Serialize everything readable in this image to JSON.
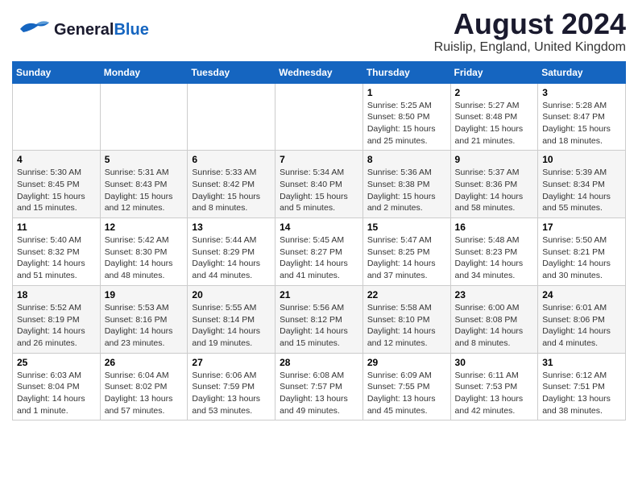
{
  "logo": {
    "general": "General",
    "blue": "Blue"
  },
  "header": {
    "month_year": "August 2024",
    "location": "Ruislip, England, United Kingdom"
  },
  "days_of_week": [
    "Sunday",
    "Monday",
    "Tuesday",
    "Wednesday",
    "Thursday",
    "Friday",
    "Saturday"
  ],
  "weeks": [
    [
      {
        "day": "",
        "info": ""
      },
      {
        "day": "",
        "info": ""
      },
      {
        "day": "",
        "info": ""
      },
      {
        "day": "",
        "info": ""
      },
      {
        "day": "1",
        "info": "Sunrise: 5:25 AM\nSunset: 8:50 PM\nDaylight: 15 hours\nand 25 minutes."
      },
      {
        "day": "2",
        "info": "Sunrise: 5:27 AM\nSunset: 8:48 PM\nDaylight: 15 hours\nand 21 minutes."
      },
      {
        "day": "3",
        "info": "Sunrise: 5:28 AM\nSunset: 8:47 PM\nDaylight: 15 hours\nand 18 minutes."
      }
    ],
    [
      {
        "day": "4",
        "info": "Sunrise: 5:30 AM\nSunset: 8:45 PM\nDaylight: 15 hours\nand 15 minutes."
      },
      {
        "day": "5",
        "info": "Sunrise: 5:31 AM\nSunset: 8:43 PM\nDaylight: 15 hours\nand 12 minutes."
      },
      {
        "day": "6",
        "info": "Sunrise: 5:33 AM\nSunset: 8:42 PM\nDaylight: 15 hours\nand 8 minutes."
      },
      {
        "day": "7",
        "info": "Sunrise: 5:34 AM\nSunset: 8:40 PM\nDaylight: 15 hours\nand 5 minutes."
      },
      {
        "day": "8",
        "info": "Sunrise: 5:36 AM\nSunset: 8:38 PM\nDaylight: 15 hours\nand 2 minutes."
      },
      {
        "day": "9",
        "info": "Sunrise: 5:37 AM\nSunset: 8:36 PM\nDaylight: 14 hours\nand 58 minutes."
      },
      {
        "day": "10",
        "info": "Sunrise: 5:39 AM\nSunset: 8:34 PM\nDaylight: 14 hours\nand 55 minutes."
      }
    ],
    [
      {
        "day": "11",
        "info": "Sunrise: 5:40 AM\nSunset: 8:32 PM\nDaylight: 14 hours\nand 51 minutes."
      },
      {
        "day": "12",
        "info": "Sunrise: 5:42 AM\nSunset: 8:30 PM\nDaylight: 14 hours\nand 48 minutes."
      },
      {
        "day": "13",
        "info": "Sunrise: 5:44 AM\nSunset: 8:29 PM\nDaylight: 14 hours\nand 44 minutes."
      },
      {
        "day": "14",
        "info": "Sunrise: 5:45 AM\nSunset: 8:27 PM\nDaylight: 14 hours\nand 41 minutes."
      },
      {
        "day": "15",
        "info": "Sunrise: 5:47 AM\nSunset: 8:25 PM\nDaylight: 14 hours\nand 37 minutes."
      },
      {
        "day": "16",
        "info": "Sunrise: 5:48 AM\nSunset: 8:23 PM\nDaylight: 14 hours\nand 34 minutes."
      },
      {
        "day": "17",
        "info": "Sunrise: 5:50 AM\nSunset: 8:21 PM\nDaylight: 14 hours\nand 30 minutes."
      }
    ],
    [
      {
        "day": "18",
        "info": "Sunrise: 5:52 AM\nSunset: 8:19 PM\nDaylight: 14 hours\nand 26 minutes."
      },
      {
        "day": "19",
        "info": "Sunrise: 5:53 AM\nSunset: 8:16 PM\nDaylight: 14 hours\nand 23 minutes."
      },
      {
        "day": "20",
        "info": "Sunrise: 5:55 AM\nSunset: 8:14 PM\nDaylight: 14 hours\nand 19 minutes."
      },
      {
        "day": "21",
        "info": "Sunrise: 5:56 AM\nSunset: 8:12 PM\nDaylight: 14 hours\nand 15 minutes."
      },
      {
        "day": "22",
        "info": "Sunrise: 5:58 AM\nSunset: 8:10 PM\nDaylight: 14 hours\nand 12 minutes."
      },
      {
        "day": "23",
        "info": "Sunrise: 6:00 AM\nSunset: 8:08 PM\nDaylight: 14 hours\nand 8 minutes."
      },
      {
        "day": "24",
        "info": "Sunrise: 6:01 AM\nSunset: 8:06 PM\nDaylight: 14 hours\nand 4 minutes."
      }
    ],
    [
      {
        "day": "25",
        "info": "Sunrise: 6:03 AM\nSunset: 8:04 PM\nDaylight: 14 hours\nand 1 minute."
      },
      {
        "day": "26",
        "info": "Sunrise: 6:04 AM\nSunset: 8:02 PM\nDaylight: 13 hours\nand 57 minutes."
      },
      {
        "day": "27",
        "info": "Sunrise: 6:06 AM\nSunset: 7:59 PM\nDaylight: 13 hours\nand 53 minutes."
      },
      {
        "day": "28",
        "info": "Sunrise: 6:08 AM\nSunset: 7:57 PM\nDaylight: 13 hours\nand 49 minutes."
      },
      {
        "day": "29",
        "info": "Sunrise: 6:09 AM\nSunset: 7:55 PM\nDaylight: 13 hours\nand 45 minutes."
      },
      {
        "day": "30",
        "info": "Sunrise: 6:11 AM\nSunset: 7:53 PM\nDaylight: 13 hours\nand 42 minutes."
      },
      {
        "day": "31",
        "info": "Sunrise: 6:12 AM\nSunset: 7:51 PM\nDaylight: 13 hours\nand 38 minutes."
      }
    ]
  ]
}
